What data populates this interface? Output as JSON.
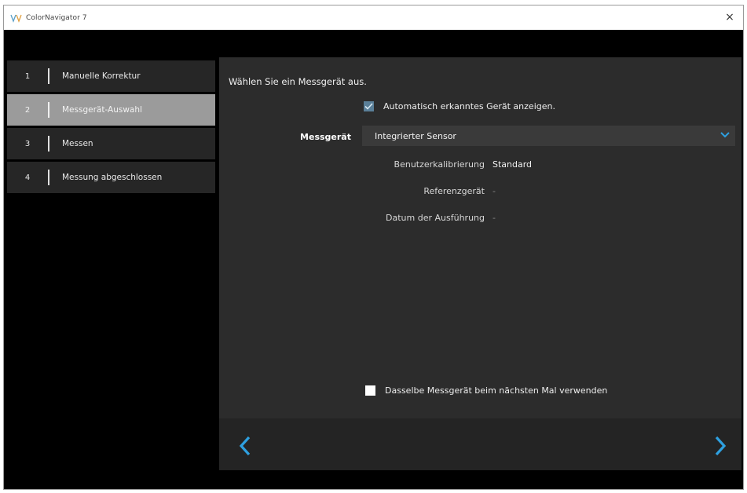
{
  "window": {
    "title": "ColorNavigator 7",
    "close_glyph": "×"
  },
  "steps": [
    {
      "num": "1",
      "label": "Manuelle Korrektur",
      "active": false
    },
    {
      "num": "2",
      "label": "Messgerät-Auswahl",
      "active": true
    },
    {
      "num": "3",
      "label": "Messen",
      "active": false
    },
    {
      "num": "4",
      "label": "Messung abgeschlossen",
      "active": false
    }
  ],
  "main": {
    "instruction": "Wählen Sie ein Messgerät aus.",
    "auto_detect": {
      "label": "Automatisch erkanntes Gerät anzeigen.",
      "checked": true
    },
    "device": {
      "label": "Messgerät",
      "selected": "Integrierter Sensor"
    },
    "info": {
      "user_calibration_label": "Benutzerkalibrierung",
      "user_calibration_value": "Standard",
      "reference_label": "Referenzgerät",
      "reference_value": "-",
      "date_label": "Datum der Ausführung",
      "date_value": "-"
    },
    "same_device": {
      "label": "Dasselbe Messgerät beim nächsten Mal verwenden",
      "checked": false
    }
  },
  "colors": {
    "accent": "#2ea0e0",
    "check": "#5a7f98",
    "active_step": "#9b9b9b"
  },
  "icons": {
    "app": "colornavigator-logo-icon",
    "close": "close-icon",
    "dropdown": "chevron-down-icon",
    "prev": "chevron-left-icon",
    "next": "chevron-right-icon"
  }
}
